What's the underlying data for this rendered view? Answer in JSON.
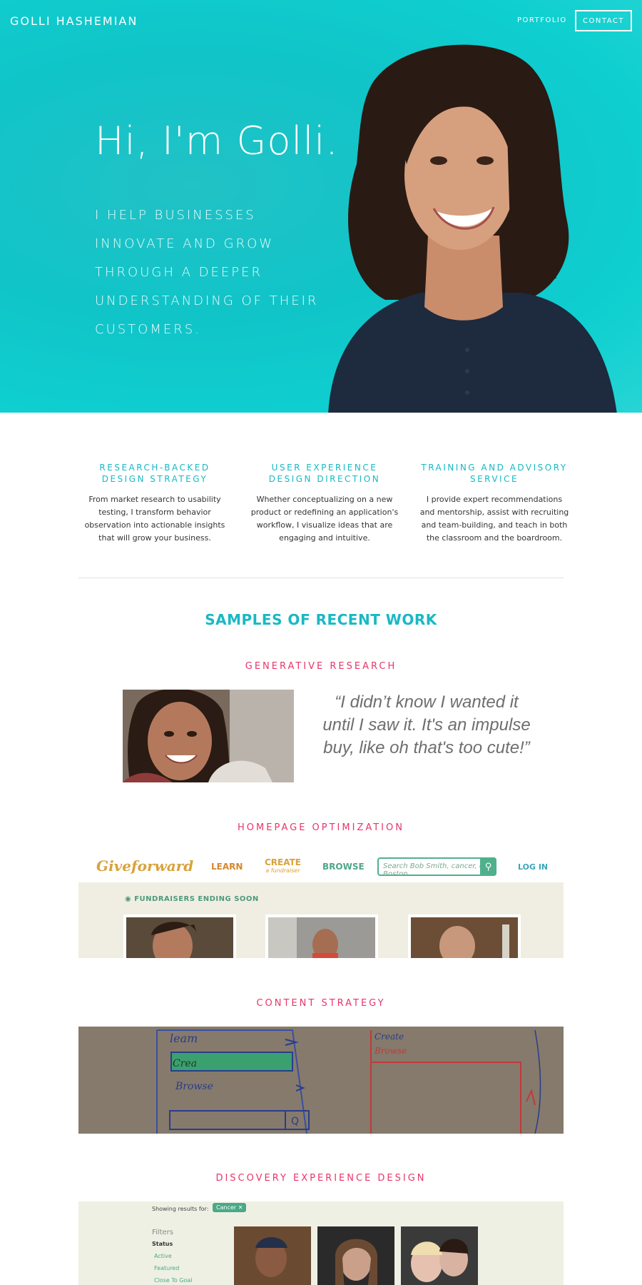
{
  "header": {
    "brand": "GOLLI HASHEMIAN",
    "nav_portfolio": "PORTFOLIO",
    "nav_contact": "CONTACT"
  },
  "hero": {
    "title": "Hi, I'm Golli.",
    "subtitle": "I HELP BUSINESSES INNOVATE AND GROW THROUGH A DEEPER UNDERSTANDING OF THEIR CUSTOMERS."
  },
  "services": [
    {
      "title": "RESEARCH-BACKED DESIGN STRATEGY",
      "body": "From market research to usability testing, I transform behavior observation into actionable insights that will grow your business."
    },
    {
      "title": "USER EXPERIENCE DESIGN DIRECTION",
      "body": "Whether conceptualizing on a new product or redefining an application's workflow, I visualize ideas that are engaging and intuitive."
    },
    {
      "title": "TRAINING AND ADVISORY SERVICE",
      "body": "I provide expert recommendations and mentorship, assist with recruiting and team-building, and teach in both the classroom and the boardroom."
    }
  ],
  "samples": {
    "title": "SAMPLES OF RECENT WORK",
    "sections": [
      {
        "label": "GENERATIVE RESEARCH"
      },
      {
        "label": "HOMEPAGE OPTIMIZATION"
      },
      {
        "label": "CONTENT STRATEGY"
      },
      {
        "label": "DISCOVERY EXPERIENCE DESIGN"
      }
    ],
    "quote": "“I didn’t know I wanted it until I saw it. It's an impulse buy, like oh that's too cute!”"
  },
  "giveforward": {
    "logo": "Giveforward",
    "learn": "LEARN",
    "create": "CREATE",
    "create_sub": "a fundraiser",
    "browse": "BROWSE",
    "search_placeholder": "Search  Bob Smith, cancer, or Boston",
    "login": "LOG IN",
    "ending_soon": "FUNDRAISERS ENDING SOON"
  },
  "discovery": {
    "showing": "Showing results for:",
    "chip": "Cancer ✕",
    "filters": "Filters",
    "status": "Status",
    "options": [
      "Active",
      "Featured",
      "Close To Goal"
    ]
  },
  "colors": {
    "hero_teal": "#10c4c8",
    "accent_teal": "#17b9c2",
    "accent_pink": "#e8356a"
  }
}
